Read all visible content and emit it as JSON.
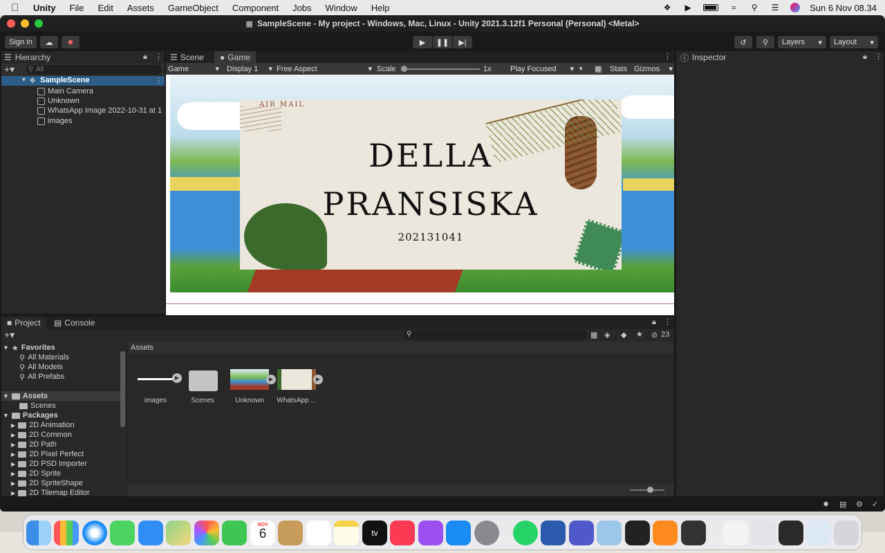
{
  "macos": {
    "app_name": "Unity",
    "menus": [
      "File",
      "Edit",
      "Assets",
      "GameObject",
      "Component",
      "Jobs",
      "Window",
      "Help"
    ],
    "datetime": "Sun 6 Nov  08.34"
  },
  "window": {
    "title": "SampleScene - My project - Windows, Mac, Linux - Unity 2021.3.12f1 Personal (Personal) <Metal>"
  },
  "toolbar": {
    "sign_in": "Sign in",
    "layers": "Layers",
    "layout": "Layout"
  },
  "hierarchy": {
    "tab": "Hierarchy",
    "search_placeholder": "All",
    "scene": "SampleScene",
    "items": [
      "Main Camera",
      "Unknown",
      "WhatsApp Image 2022-10-31 at 1",
      "images"
    ]
  },
  "game_view": {
    "tabs": [
      "Scene",
      "Game"
    ],
    "mode": "Game",
    "display": "Display 1",
    "aspect": "Free Aspect",
    "scale_label": "Scale",
    "scale_value": "1x",
    "play_focused": "Play Focused",
    "stats": "Stats",
    "gizmos": "Gizmos",
    "card_line1": "DELLA",
    "card_line2": "PRANSISKA",
    "card_number": "202131041",
    "stamp_text": "AIR MAIL"
  },
  "inspector": {
    "tab": "Inspector"
  },
  "project": {
    "tabs": [
      "Project",
      "Console"
    ],
    "hidden_count": "23",
    "favorites_label": "Favorites",
    "favorites": [
      "All Materials",
      "All Models",
      "All Prefabs"
    ],
    "assets_label": "Assets",
    "assets_children": [
      "Scenes"
    ],
    "packages_label": "Packages",
    "packages": [
      "2D Animation",
      "2D Common",
      "2D Path",
      "2D Pixel Perfect",
      "2D PSD Importer",
      "2D Sprite",
      "2D SpriteShape",
      "2D Tilemap Editor"
    ],
    "breadcrumb": "Assets",
    "asset_items": [
      "images",
      "Scenes",
      "Unknown",
      "WhatsApp ..."
    ]
  },
  "dock": {
    "calendar_month": "NOV",
    "calendar_day": "6",
    "tv_label": "tv"
  },
  "colors": {
    "unity_bg": "#282828",
    "selection": "#2c5d87",
    "sky": "#cde3f0",
    "water": "#3f8fd6",
    "card": "#ece7dc"
  }
}
